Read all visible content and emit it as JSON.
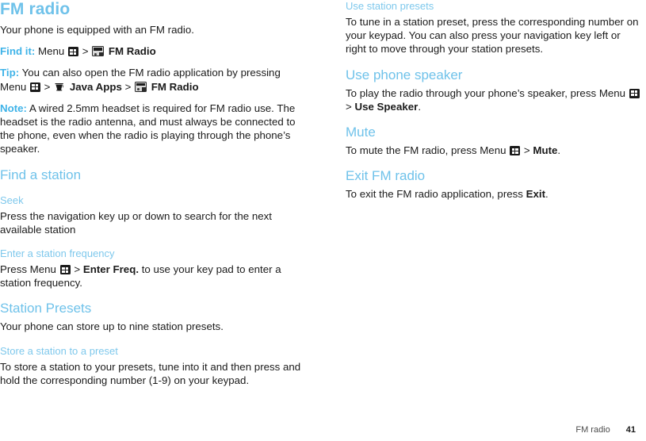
{
  "document": {
    "title": "FM radio",
    "footer": {
      "section": "FM radio",
      "page_number": "41"
    },
    "colors": {
      "heading_blue": "#6fc2ea",
      "subheading_blue": "#7ec8ec",
      "lead_blue": "#3fb3e8",
      "body_text": "#1b1b1b",
      "background": "#ffffff"
    }
  },
  "icons": {
    "menu": "menu-grid-icon",
    "radio": "fm-radio-app-icon",
    "java": "java-apps-coffee-cup-icon"
  },
  "left_column": {
    "title": "FM radio",
    "intro": "Your phone is equipped with an FM radio.",
    "find_it": {
      "lead": "Find it:",
      "word_menu": "Menu",
      "sep": ">",
      "target": "FM Radio"
    },
    "tip": {
      "lead": "Tip:",
      "text_part1": "You can also open the FM radio application by pressing Menu",
      "sep1": ">",
      "java_apps": "Java Apps",
      "sep2": ">",
      "fm_radio": "FM Radio"
    },
    "note": {
      "lead": "Note:",
      "text": "A wired 2.5mm headset is required for FM radio use. The headset is the radio antenna, and must always be connected to the phone, even when the radio is playing through the phone’s speaker."
    },
    "find_a_station": {
      "heading": "Find a station",
      "seek": {
        "subheading": "Seek",
        "body": "Press the navigation key up or down to search for the next available station"
      },
      "enter_freq": {
        "subheading": "Enter a station frequency",
        "body_part1": "Press Menu",
        "sep": ">",
        "command": "Enter Freq.",
        "body_part2": "to use your key pad to enter a station frequency."
      }
    },
    "station_presets": {
      "heading": "Station Presets",
      "body": "Your phone can store up to nine station presets.",
      "store": {
        "subheading": "Store a station to a preset",
        "body": "To store a station to your presets, tune into it and then press and hold the corresponding number (1-9) on your keypad."
      }
    }
  },
  "right_column": {
    "use_presets": {
      "subheading": "Use station presets",
      "body": "To tune in a station preset, press the corresponding number on your keypad. You can also press your navigation key left or right to move through your station presets."
    },
    "use_speaker": {
      "heading": "Use phone speaker",
      "body_part1": "To play the radio through your phone’s speaker, press Menu",
      "sep": ">",
      "command": "Use Speaker",
      "period": "."
    },
    "mute": {
      "heading": "Mute",
      "body_part1": "To mute the FM radio, press Menu",
      "sep": ">",
      "command": "Mute",
      "period": "."
    },
    "exit": {
      "heading": "Exit FM radio",
      "body_part1": "To exit the FM radio application, press",
      "command": "Exit",
      "period": "."
    }
  }
}
